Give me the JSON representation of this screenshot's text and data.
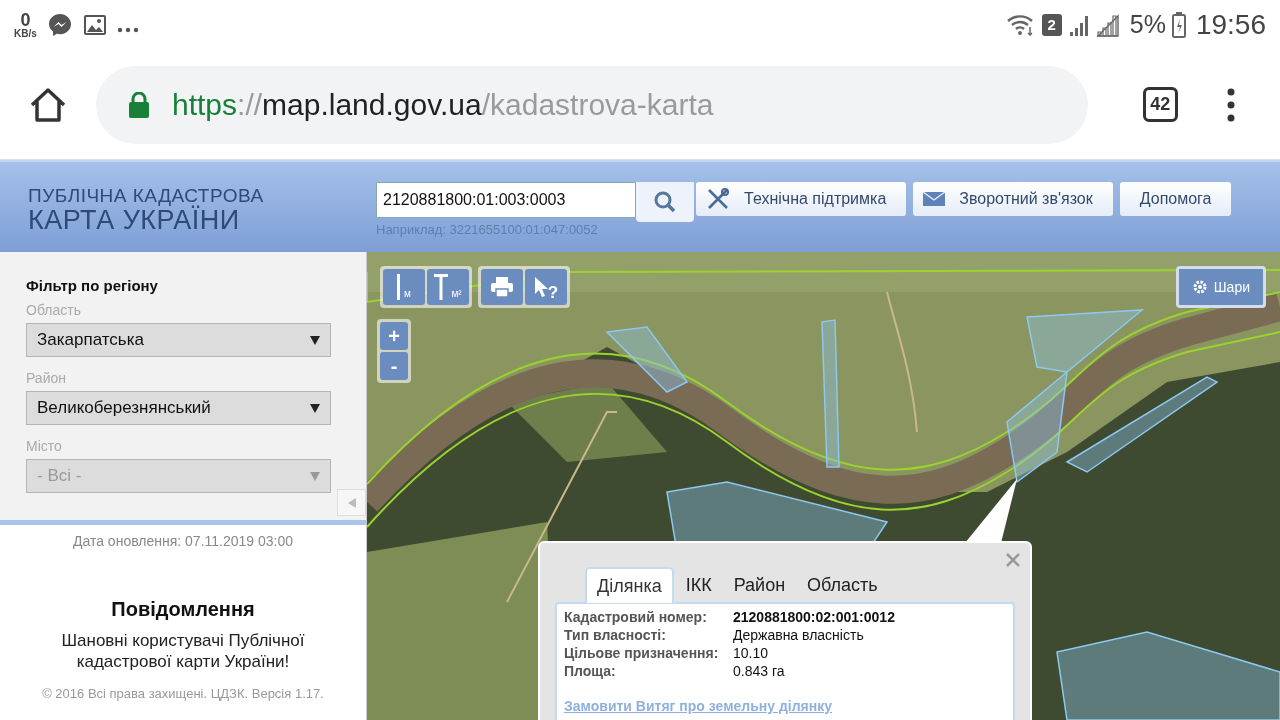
{
  "status_bar": {
    "speed_value": "0",
    "speed_unit": "KB/s",
    "sim_badge": "2",
    "battery_percent": "5%",
    "time": "19:56"
  },
  "browser": {
    "url": {
      "scheme": "https",
      "separator": "://",
      "host": "map.land.gov.ua",
      "path": "/kadastrova-karta"
    },
    "tab_count": "42"
  },
  "header": {
    "logo_line_1": "ПУБЛІЧНА КАДАСТРОВА",
    "logo_line_2": "КАРТА УКРАЇНИ",
    "search": {
      "value": "2120881800:01:003:0003",
      "hint": "Наприклад: 3221655100:01:047:0052"
    },
    "buttons": [
      {
        "kind": "tools",
        "label": "Технічна підтримка"
      },
      {
        "kind": "mail",
        "label": "Зворотний зв'язок"
      },
      {
        "kind": "plain",
        "label": "Допомога"
      }
    ]
  },
  "sidebar": {
    "title": "Фільтр по регіону",
    "filters": [
      {
        "label": "Область",
        "value": "Закарпатська",
        "disabled": false
      },
      {
        "label": "Район",
        "value": "Великоберезнянський",
        "disabled": false
      },
      {
        "label": "Місто",
        "value": "- Всі -",
        "disabled": true
      }
    ],
    "updated": "Дата оновлення: 07.11.2019 03:00",
    "notice_title": "Повідомлення",
    "notice_text": "Шановні користувачі Публічної кадастрової карти України!",
    "copyright": "© 2016 Всі права захищені. ЦДЗК. Версія 1.17."
  },
  "map": {
    "tools": [
      {
        "kind": "length",
        "label": "м"
      },
      {
        "kind": "area",
        "label": "м²"
      },
      {
        "kind": "print"
      },
      {
        "kind": "identify",
        "label": "?"
      }
    ],
    "zoom_in": "+",
    "zoom_out": "-",
    "layers_button": "Шари",
    "popup": {
      "tabs": [
        {
          "label": "Ділянка",
          "selected": true
        },
        {
          "label": "ІКК",
          "selected": false
        },
        {
          "label": "Район",
          "selected": false
        },
        {
          "label": "Область",
          "selected": false
        }
      ],
      "rows": [
        {
          "label": "Кадастровий номер:",
          "value": "2120881800:02:001:0012",
          "bold": true
        },
        {
          "label": "Тип власності:",
          "value": "Державна власність",
          "bold": false
        },
        {
          "label": "Цільове призначення:",
          "value": "10.10",
          "bold": false
        },
        {
          "label": "Площа:",
          "value": "0.843 га",
          "bold": false
        }
      ],
      "link": "Замовити Витяг про земельну ділянку"
    }
  }
}
